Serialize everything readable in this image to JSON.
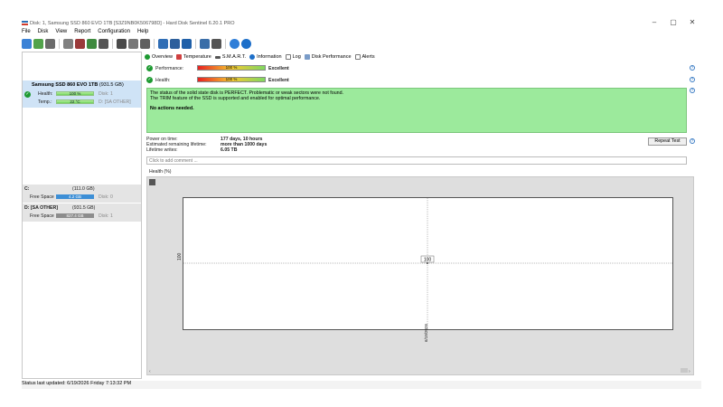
{
  "window": {
    "title": "Disk: 1, Samsung SSD 860 EVO 1TB [S3Z9NB0K506798D]  -  Hard Disk Sentinel 6.20.1 PRO",
    "controls": [
      "–",
      "▢",
      "✕"
    ]
  },
  "menu": [
    "File",
    "Disk",
    "View",
    "Report",
    "Configuration",
    "Help"
  ],
  "left": {
    "disk_name": "Samsung SSD 860 EVO 1TB",
    "disk_size": "(931.5 GB)",
    "health_label": "Health:",
    "health_value": "100 %",
    "health_fraction": 1.0,
    "disk_index": "Disk: 1",
    "temp_label": "Temp.:",
    "temp_value": "22 °C",
    "temp_fraction": 0.9,
    "volume_label": "D: [SA OTHER]",
    "volumes": [
      {
        "letter": "C:",
        "size": "(111.0 GB)",
        "free_label": "Free Space",
        "free_value": "4.2 GB",
        "free_fraction": 1.0,
        "disk": "Disk: 0"
      },
      {
        "letter": "D: [SA OTHER]",
        "size": "(931.5 GB)",
        "free_label": "Free Space",
        "free_value": "827.4 GB",
        "free_fraction": 1.0,
        "disk": "Disk: 1"
      }
    ]
  },
  "tabs": [
    "Overview",
    "Temperature",
    "S.M.A.R.T.",
    "Information",
    "Log",
    "Disk Performance",
    "Alerts"
  ],
  "overview": {
    "performance_label": "Performance:",
    "performance_value": "100 %",
    "performance_rating": "Excellent",
    "health_label": "Health:",
    "health_value": "100 %",
    "health_rating": "Excellent",
    "status_line1": "The status of the solid state disk is PERFECT. Problematic or weak sectors were not found.",
    "status_line2": "The TRIM feature of the SSD is supported and enabled for optimal performance.",
    "status_action": "No actions needed.",
    "power_on_label": "Power on time:",
    "power_on_value": "177 days, 10 hours",
    "remaining_label": "Estimated remaining lifetime:",
    "remaining_value": "more than 1000 days",
    "writes_label": "Lifetime writes:",
    "writes_value": "6.05 TB",
    "repeat_button": "Repeat Test",
    "comment_placeholder": "Click to add comment ...",
    "graph_title": "Health (%)"
  },
  "chart_data": {
    "type": "line",
    "title": "Health (%)",
    "x": [
      "6/19/2026"
    ],
    "series": [
      {
        "values": [
          100
        ]
      }
    ],
    "ylabel": "",
    "xlabel": "",
    "y_tick": "100",
    "data_label": "100",
    "x_tick": "6/19/2026"
  },
  "statusbar": "Status last updated: 6/19/2026 Friday 7:13:32 PM",
  "colors": {
    "selected": "#cfe3f6",
    "status_green": "#9cea9c",
    "check_green": "#1e9a32",
    "volume_blue": "#3d8fd6"
  }
}
